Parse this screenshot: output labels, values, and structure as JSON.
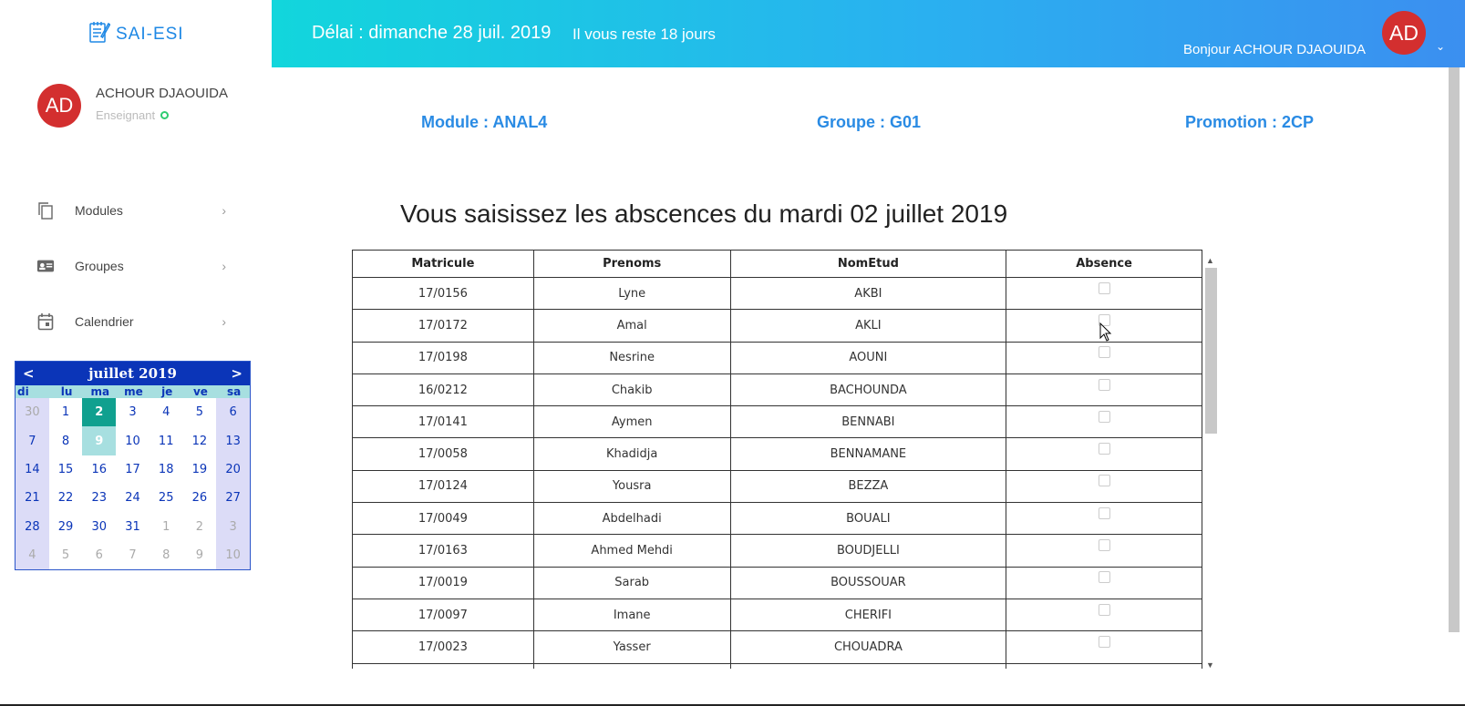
{
  "brand": {
    "name": "SAI-ESI",
    "icon": "notepad-icon"
  },
  "profile": {
    "initials": "AD",
    "name": "ACHOUR DJAOUIDA",
    "role": "Enseignant"
  },
  "nav": [
    {
      "label": "Modules",
      "icon": "copy-icon"
    },
    {
      "label": "Groupes",
      "icon": "id-card-icon"
    },
    {
      "label": "Calendrier",
      "icon": "calendar-icon"
    }
  ],
  "calendar": {
    "month_label": "juillet 2019",
    "prev": "<",
    "next": ">",
    "dow": [
      "di",
      "lu",
      "ma",
      "me",
      "je",
      "ve",
      "sa"
    ],
    "weeks": [
      [
        "30",
        "1",
        "2",
        "3",
        "4",
        "5",
        "6"
      ],
      [
        "7",
        "8",
        "9",
        "10",
        "11",
        "12",
        "13"
      ],
      [
        "14",
        "15",
        "16",
        "17",
        "18",
        "19",
        "20"
      ],
      [
        "21",
        "22",
        "23",
        "24",
        "25",
        "26",
        "27"
      ],
      [
        "28",
        "29",
        "30",
        "31",
        "1",
        "2",
        "3"
      ],
      [
        "4",
        "5",
        "6",
        "7",
        "8",
        "9",
        "10"
      ]
    ],
    "selected_day": "2",
    "today_day": "9",
    "colors": {
      "header": "#0b35b8",
      "selected": "#10a08f",
      "today": "#a7dfe0",
      "weekend": "#dcdcf7"
    }
  },
  "header": {
    "deadline": "Délai : dimanche 28 juil. 2019",
    "remaining": "Il vous reste 18 jours",
    "greeting": "Bonjour ACHOUR DJAOUIDA",
    "initials": "AD",
    "menu_icon": "chevron-down-icon"
  },
  "info": {
    "module": "Module : ANAL4",
    "group": "Groupe : G01",
    "promotion": "Promotion : 2CP"
  },
  "title": "Vous saisissez les abscences du mardi 02 juillet 2019",
  "table": {
    "columns": [
      "Matricule",
      "Prenoms",
      "NomEtud",
      "Absence"
    ],
    "rows": [
      {
        "matricule": "17/0156",
        "prenom": "Lyne",
        "nom": "AKBI",
        "absent": false
      },
      {
        "matricule": "17/0172",
        "prenom": "Amal",
        "nom": "AKLI",
        "absent": false
      },
      {
        "matricule": "17/0198",
        "prenom": "Nesrine",
        "nom": "AOUNI",
        "absent": false
      },
      {
        "matricule": "16/0212",
        "prenom": "Chakib",
        "nom": "BACHOUNDA",
        "absent": false
      },
      {
        "matricule": "17/0141",
        "prenom": "Aymen",
        "nom": "BENNABI",
        "absent": false
      },
      {
        "matricule": "17/0058",
        "prenom": "Khadidja",
        "nom": "BENNAMANE",
        "absent": false
      },
      {
        "matricule": "17/0124",
        "prenom": "Yousra",
        "nom": "BEZZA",
        "absent": false
      },
      {
        "matricule": "17/0049",
        "prenom": "Abdelhadi",
        "nom": "BOUALI",
        "absent": false
      },
      {
        "matricule": "17/0163",
        "prenom": "Ahmed Mehdi",
        "nom": "BOUDJELLI",
        "absent": false
      },
      {
        "matricule": "17/0019",
        "prenom": "Sarab",
        "nom": "BOUSSOUAR",
        "absent": false
      },
      {
        "matricule": "17/0097",
        "prenom": "Imane",
        "nom": "CHERIFI",
        "absent": false
      },
      {
        "matricule": "17/0023",
        "prenom": "Yasser",
        "nom": "CHOUADRA",
        "absent": false
      },
      {
        "matricule": "",
        "prenom": "",
        "nom": "",
        "absent": false
      }
    ]
  },
  "colors": {
    "accent": "#2a8be4",
    "avatar": "#d32f2f",
    "gradient_start": "#12d6dc",
    "gradient_end": "#3b8ff0"
  }
}
